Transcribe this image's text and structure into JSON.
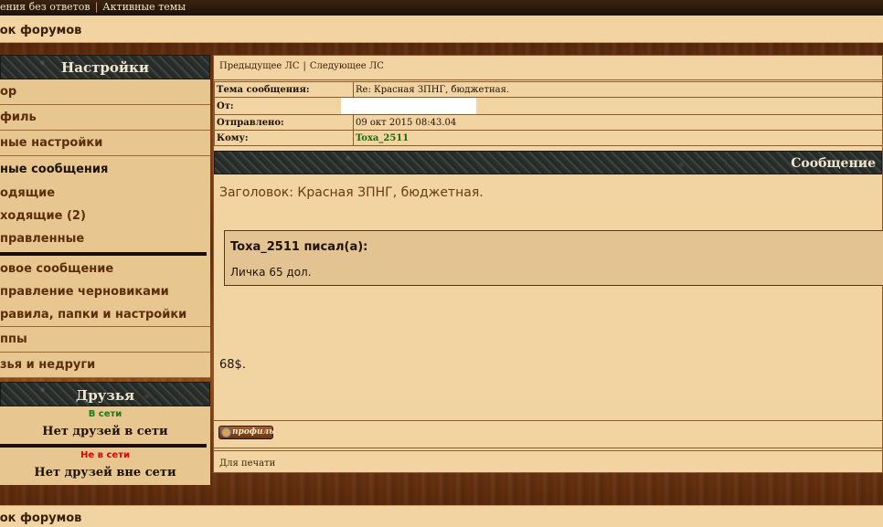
{
  "topbar": {
    "link1": "ения без ответов",
    "link2": "Активные темы"
  },
  "navbar": {
    "label": "сок форумов"
  },
  "footer": {
    "label": "сок форумов"
  },
  "sidebar": {
    "settings_title": "Настройки",
    "items": [
      "ор",
      "филь",
      "ные настройки"
    ],
    "pm_group": {
      "title": "ные сообщения",
      "links": [
        "одящие",
        "ходящие (2)",
        "правленные"
      ],
      "actions": [
        "овое сообщение",
        "правление черновиками",
        "равила, папки и настройки"
      ]
    },
    "tail_items": [
      "ппы",
      "зья и недруги"
    ],
    "friends_title": "Друзья",
    "online_label": "В сети",
    "online_value": "Нет друзей в сети",
    "offline_label": "Не в сети",
    "offline_value": "Нет друзей вне сети"
  },
  "pm_nav": {
    "prev": "Предыдущее ЛС",
    "next": "Следующее ЛС"
  },
  "info": {
    "subject_label": "Тема сообщения:",
    "subject_value": "Re: Красная ЗПНГ, бюджетная.",
    "from_label": "От:",
    "sent_label": "Отправлено:",
    "sent_value": "09 окт 2015 08:43.04",
    "to_label": "Кому:",
    "to_value": "Toxa_2511"
  },
  "message": {
    "header": "Сообщение",
    "subject_line": "Заголовок: Красная ЗПНГ, бюджетная.",
    "quote_author": "Toxa_2511 писал(а):",
    "quote_text": "Личка 65 дол.",
    "answer": "68$."
  },
  "buttons": {
    "profile": "профиль"
  },
  "print_label": "Для печати"
}
